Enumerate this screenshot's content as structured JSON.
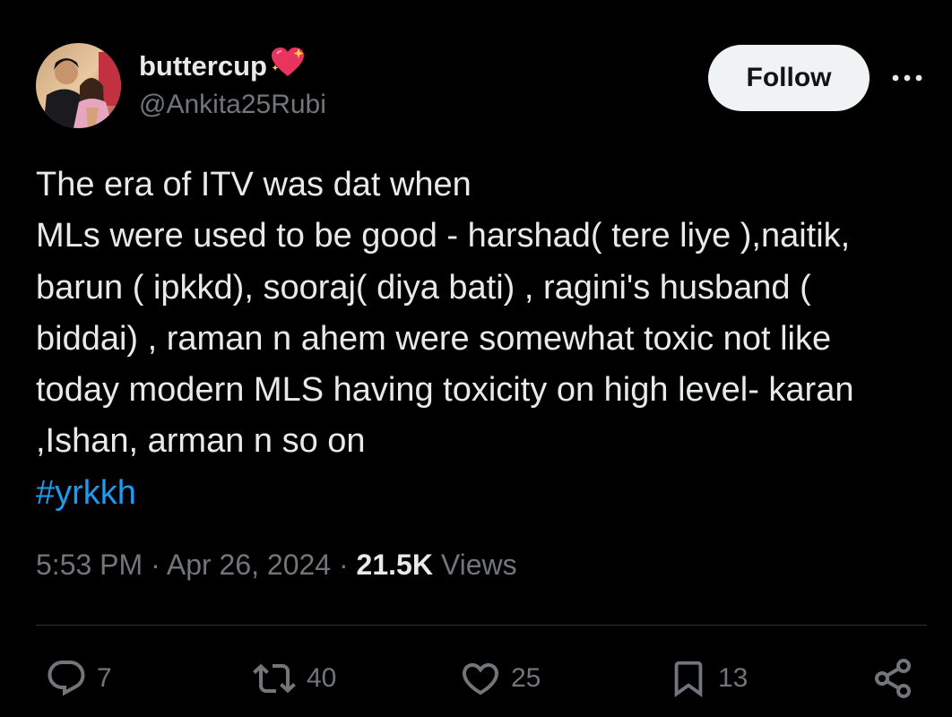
{
  "author": {
    "display_name": "buttercup",
    "handle": "@Ankita25Rubi",
    "emoji_icon": "sparkling-heart-icon"
  },
  "follow_label": "Follow",
  "more_icon": "more-horizontal-icon",
  "tweet": {
    "lines": [
      "The era of  ITV was dat when",
      "MLs were used to be good - harshad( tere liye ),naitik,",
      "barun ( ipkkd), sooraj( diya bati) , ragini's husband (",
      "biddai) , raman n ahem were somewhat toxic not like",
      "today modern MLS  having toxicity on high level- karan",
      ",Ishan, arman n so on"
    ],
    "hashtag": "#yrkkh"
  },
  "meta": {
    "time": "5:53 PM",
    "sep1": " · ",
    "date": "Apr 26, 2024",
    "sep2": " · ",
    "views_count": "21.5K",
    "views_label": " Views"
  },
  "actions": {
    "replies": "7",
    "reposts": "40",
    "likes": "25",
    "bookmarks": "13"
  },
  "colors": {
    "background": "#000000",
    "text": "#e7e9ea",
    "secondary": "#71767b",
    "link": "#1d9bf0",
    "follow_bg": "#eff3f4"
  }
}
